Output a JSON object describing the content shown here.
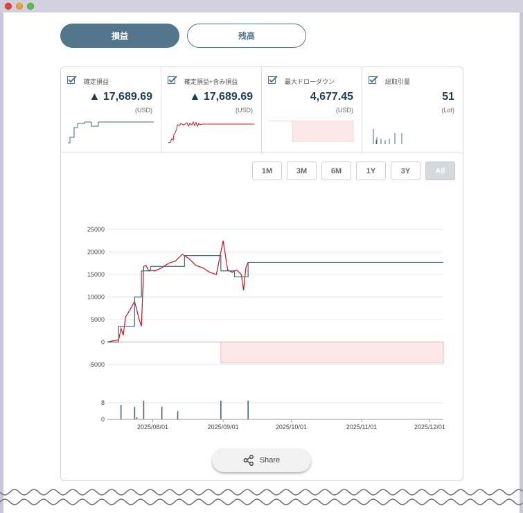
{
  "tabs": [
    {
      "label": "損益",
      "active": true
    },
    {
      "label": "残高",
      "active": false
    }
  ],
  "stats": [
    {
      "label": "確定損益",
      "value": "▲ 17,689.69",
      "unit": "(USD)",
      "checked": true
    },
    {
      "label": "確定損益+含み損益",
      "value": "▲ 17,689.69",
      "unit": "(USD)",
      "checked": true
    },
    {
      "label": "最大ドローダウン",
      "value": "4,677.45",
      "unit": "(USD)",
      "checked": true
    },
    {
      "label": "総取引量",
      "value": "51",
      "unit": "(Lot)",
      "checked": true
    }
  ],
  "ranges": [
    {
      "label": "1M",
      "active": false
    },
    {
      "label": "3M",
      "active": false
    },
    {
      "label": "6M",
      "active": false
    },
    {
      "label": "1Y",
      "active": false
    },
    {
      "label": "3Y",
      "active": false
    },
    {
      "label": "All",
      "active": true
    }
  ],
  "share_label": "Share",
  "colors": {
    "accent": "#54768c",
    "realized_line": "#4a6478",
    "unrealized_line": "#d0101e",
    "drawdown_fill": "#fde8e8",
    "drawdown_stroke": "#f3b6b6",
    "volume_bar": "#4a6478"
  },
  "chart_data": [
    {
      "type": "line",
      "ylim": [
        -7500,
        25000
      ],
      "y_ticks": [
        "25000",
        "20000",
        "15000",
        "10000",
        "5000",
        "0",
        "-5000"
      ],
      "x_ticks": [
        "2025/08/01",
        "2025/09/01",
        "2025/10/01",
        "2025/11/01",
        "2025/12/01"
      ],
      "grid": true,
      "series": [
        {
          "key": "realized",
          "x": [
            "2025-07-12",
            "2025-07-17",
            "2025-07-17",
            "2025-07-24",
            "2025-07-24",
            "2025-07-27",
            "2025-07-27",
            "2025-07-31",
            "2025-07-31",
            "2025-08-02",
            "2025-08-02",
            "2025-08-15",
            "2025-08-15",
            "2025-08-22",
            "2025-08-22",
            "2025-08-31",
            "2025-08-31",
            "2025-09-06",
            "2025-09-06",
            "2025-09-12",
            "2025-09-12",
            "2025-12-07"
          ],
          "y": [
            0,
            0,
            3500,
            3500,
            10000,
            10000,
            15800,
            15800,
            16800,
            16800,
            16800,
            16800,
            19200,
            19200,
            19200,
            19200,
            15800,
            15800,
            14500,
            14500,
            17690,
            17690
          ]
        },
        {
          "key": "unrealized",
          "x": [
            "2025-07-12",
            "2025-07-17",
            "2025-07-18",
            "2025-07-19",
            "2025-07-20",
            "2025-07-22",
            "2025-07-24",
            "2025-07-26",
            "2025-07-27",
            "2025-07-28",
            "2025-07-29",
            "2025-07-30",
            "2025-08-02",
            "2025-08-05",
            "2025-08-08",
            "2025-08-11",
            "2025-08-14",
            "2025-08-17",
            "2025-08-20",
            "2025-08-23",
            "2025-08-26",
            "2025-08-29",
            "2025-09-01",
            "2025-09-03",
            "2025-09-05",
            "2025-09-07",
            "2025-09-09",
            "2025-09-10",
            "2025-09-11",
            "2025-09-12"
          ],
          "y": [
            0,
            500,
            3000,
            1500,
            5500,
            7200,
            9000,
            5000,
            3500,
            16800,
            17000,
            16000,
            15800,
            16500,
            17500,
            18000,
            19500,
            18500,
            17000,
            16500,
            15500,
            15000,
            22500,
            16000,
            15500,
            16000,
            15000,
            11500,
            16500,
            17690
          ]
        },
        {
          "key": "drawdown",
          "x": [
            "2025-07-12",
            "2025-08-31",
            "2025-08-31",
            "2025-12-07"
          ],
          "y": [
            0,
            0,
            -4677.45,
            -4677.45
          ]
        }
      ]
    },
    {
      "type": "bar",
      "ylim": [
        0,
        10
      ],
      "y_ticks": [
        "8",
        "0"
      ],
      "x": [
        "2025-07-18",
        "2025-07-24",
        "2025-07-25",
        "2025-07-28",
        "2025-08-05",
        "2025-08-12",
        "2025-08-31",
        "2025-09-12"
      ],
      "values": [
        7,
        6,
        1,
        9,
        6,
        4,
        9,
        9
      ]
    }
  ]
}
